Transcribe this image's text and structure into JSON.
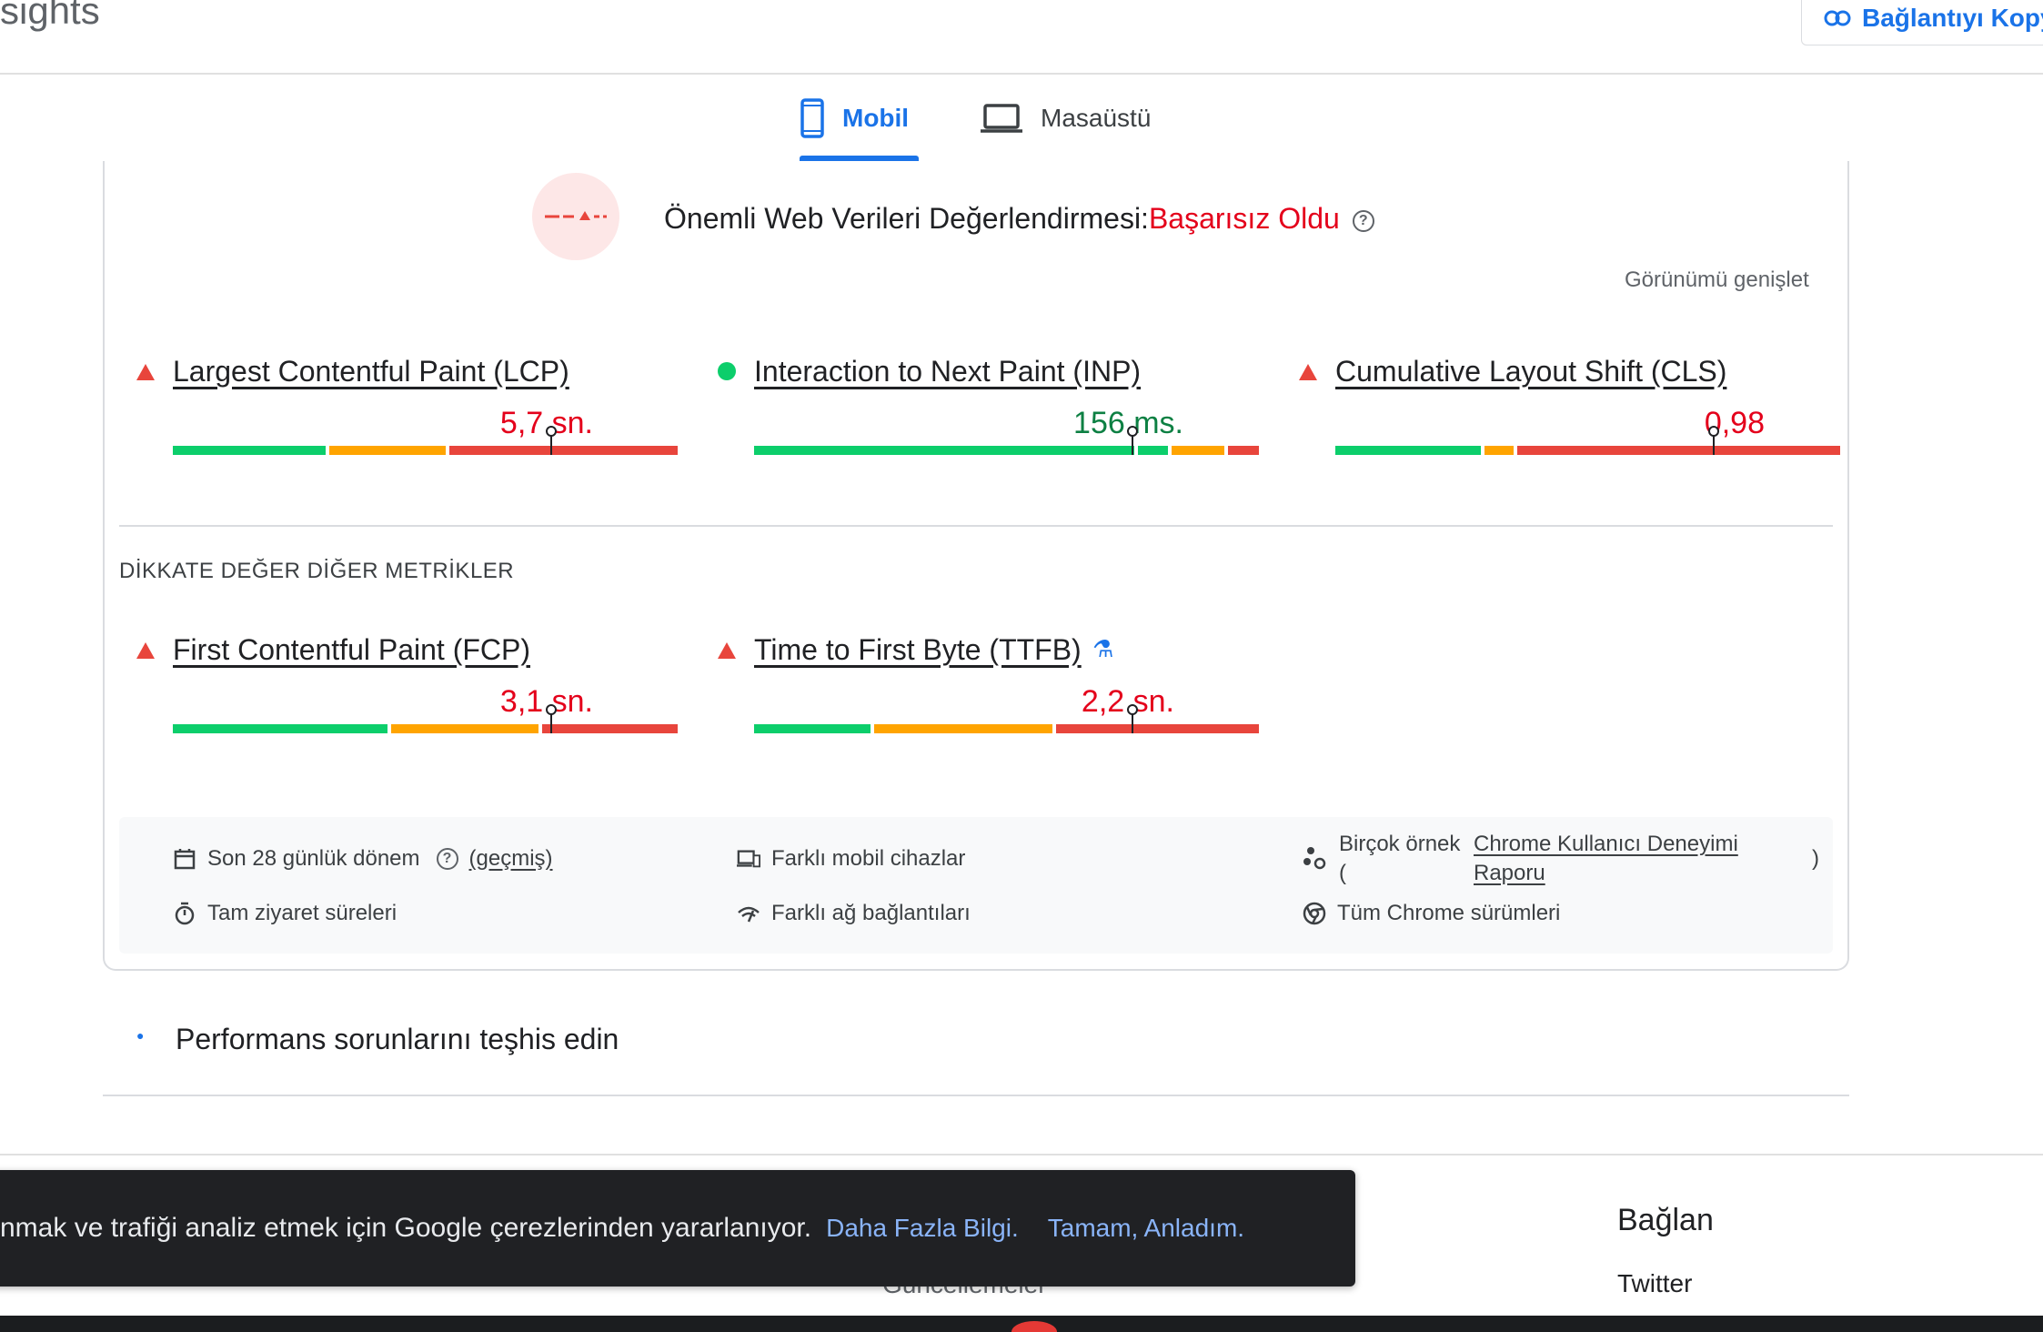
{
  "header": {
    "title": "sights",
    "copy_link_label": "Bağlantıyı Kopy"
  },
  "tabs": [
    {
      "label": "Mobil",
      "selected": true
    },
    {
      "label": "Masaüstü",
      "selected": false
    }
  ],
  "assessment": {
    "title": "Önemli Web Verileri Değerlendirmesi:",
    "status": "Başarısız Oldu",
    "expand_label": "Görünümü genişlet"
  },
  "core_metrics": [
    {
      "name": "Largest Contentful Paint (LCP)",
      "value": "5,7 sn.",
      "rating": "poor",
      "marker_pct": 75
    },
    {
      "name": "Interaction to Next Paint (INP)",
      "value": "156 ms.",
      "rating": "good",
      "marker_pct": 75
    },
    {
      "name": "Cumulative Layout Shift (CLS)",
      "value": "0,98",
      "rating": "poor",
      "marker_pct": 75
    }
  ],
  "other_metrics_label": "DİKKATE DEĞER DİĞER METRİKLER",
  "other_metrics": [
    {
      "name": "First Contentful Paint (FCP)",
      "value": "3,1 sn.",
      "rating": "poor",
      "marker_pct": 75
    },
    {
      "name": "Time to First Byte (TTFB)",
      "value": "2,2 sn.",
      "rating": "poor",
      "marker_pct": 75
    }
  ],
  "info": {
    "period": "Son 28 günlük dönem",
    "history_link": "(geçmiş)",
    "full_visits": "Tam ziyaret süreleri",
    "devices": "Farklı mobil cihazlar",
    "network": "Farklı ağ bağlantıları",
    "samples_prefix": "Birçok örnek",
    "samples_paren_open": "(",
    "crux_link_1": "Chrome Kullanıcı Deneyimi",
    "crux_link_2": "Raporu",
    "samples_paren_close": ")",
    "chrome_versions": "Tüm Chrome sürümleri"
  },
  "diagnose": {
    "title": "Performans sorunlarını teşhis edin"
  },
  "footer": {
    "heading": "Bağlan",
    "twitter": "Twitter",
    "partial_link": "Güncellemeler"
  },
  "cookie_banner": {
    "text": "nmak ve trafiği analiz etmek için Google çerezlerinden yararlanıyor.",
    "learn_more": "Daha Fazla Bilgi.",
    "ok": "Tamam, Anladım."
  },
  "colors": {
    "accent": "#1a73e8",
    "good": "#0cce6b",
    "needs_improvement": "#ffa400",
    "poor": "#e8453c",
    "fail_text": "#e4001b"
  }
}
